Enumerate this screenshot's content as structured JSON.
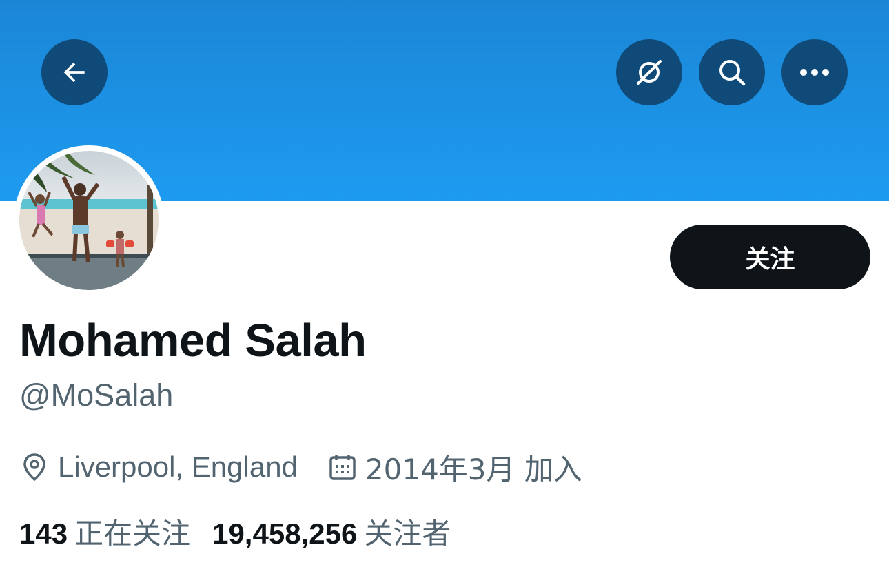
{
  "header": {
    "back_icon": "arrow-left-icon",
    "hide_icon": "eye-slash-icon",
    "search_icon": "search-icon",
    "more_icon": "ellipsis-icon",
    "banner_color": "#1d9bf0",
    "button_color": "#0f4a78"
  },
  "profile": {
    "avatar_description_icon": "avatar-photo",
    "follow_label": "关注",
    "name": "Mohamed Salah",
    "handle": "@MoSalah",
    "location_icon": "location-pin-icon",
    "location": "Liverpool, England",
    "joined_icon": "calendar-icon",
    "joined": "2014年3月 加入"
  },
  "stats": {
    "following_count": "143",
    "following_label": "正在关注",
    "followers_count": "19,458,256",
    "followers_label": "关注者"
  }
}
